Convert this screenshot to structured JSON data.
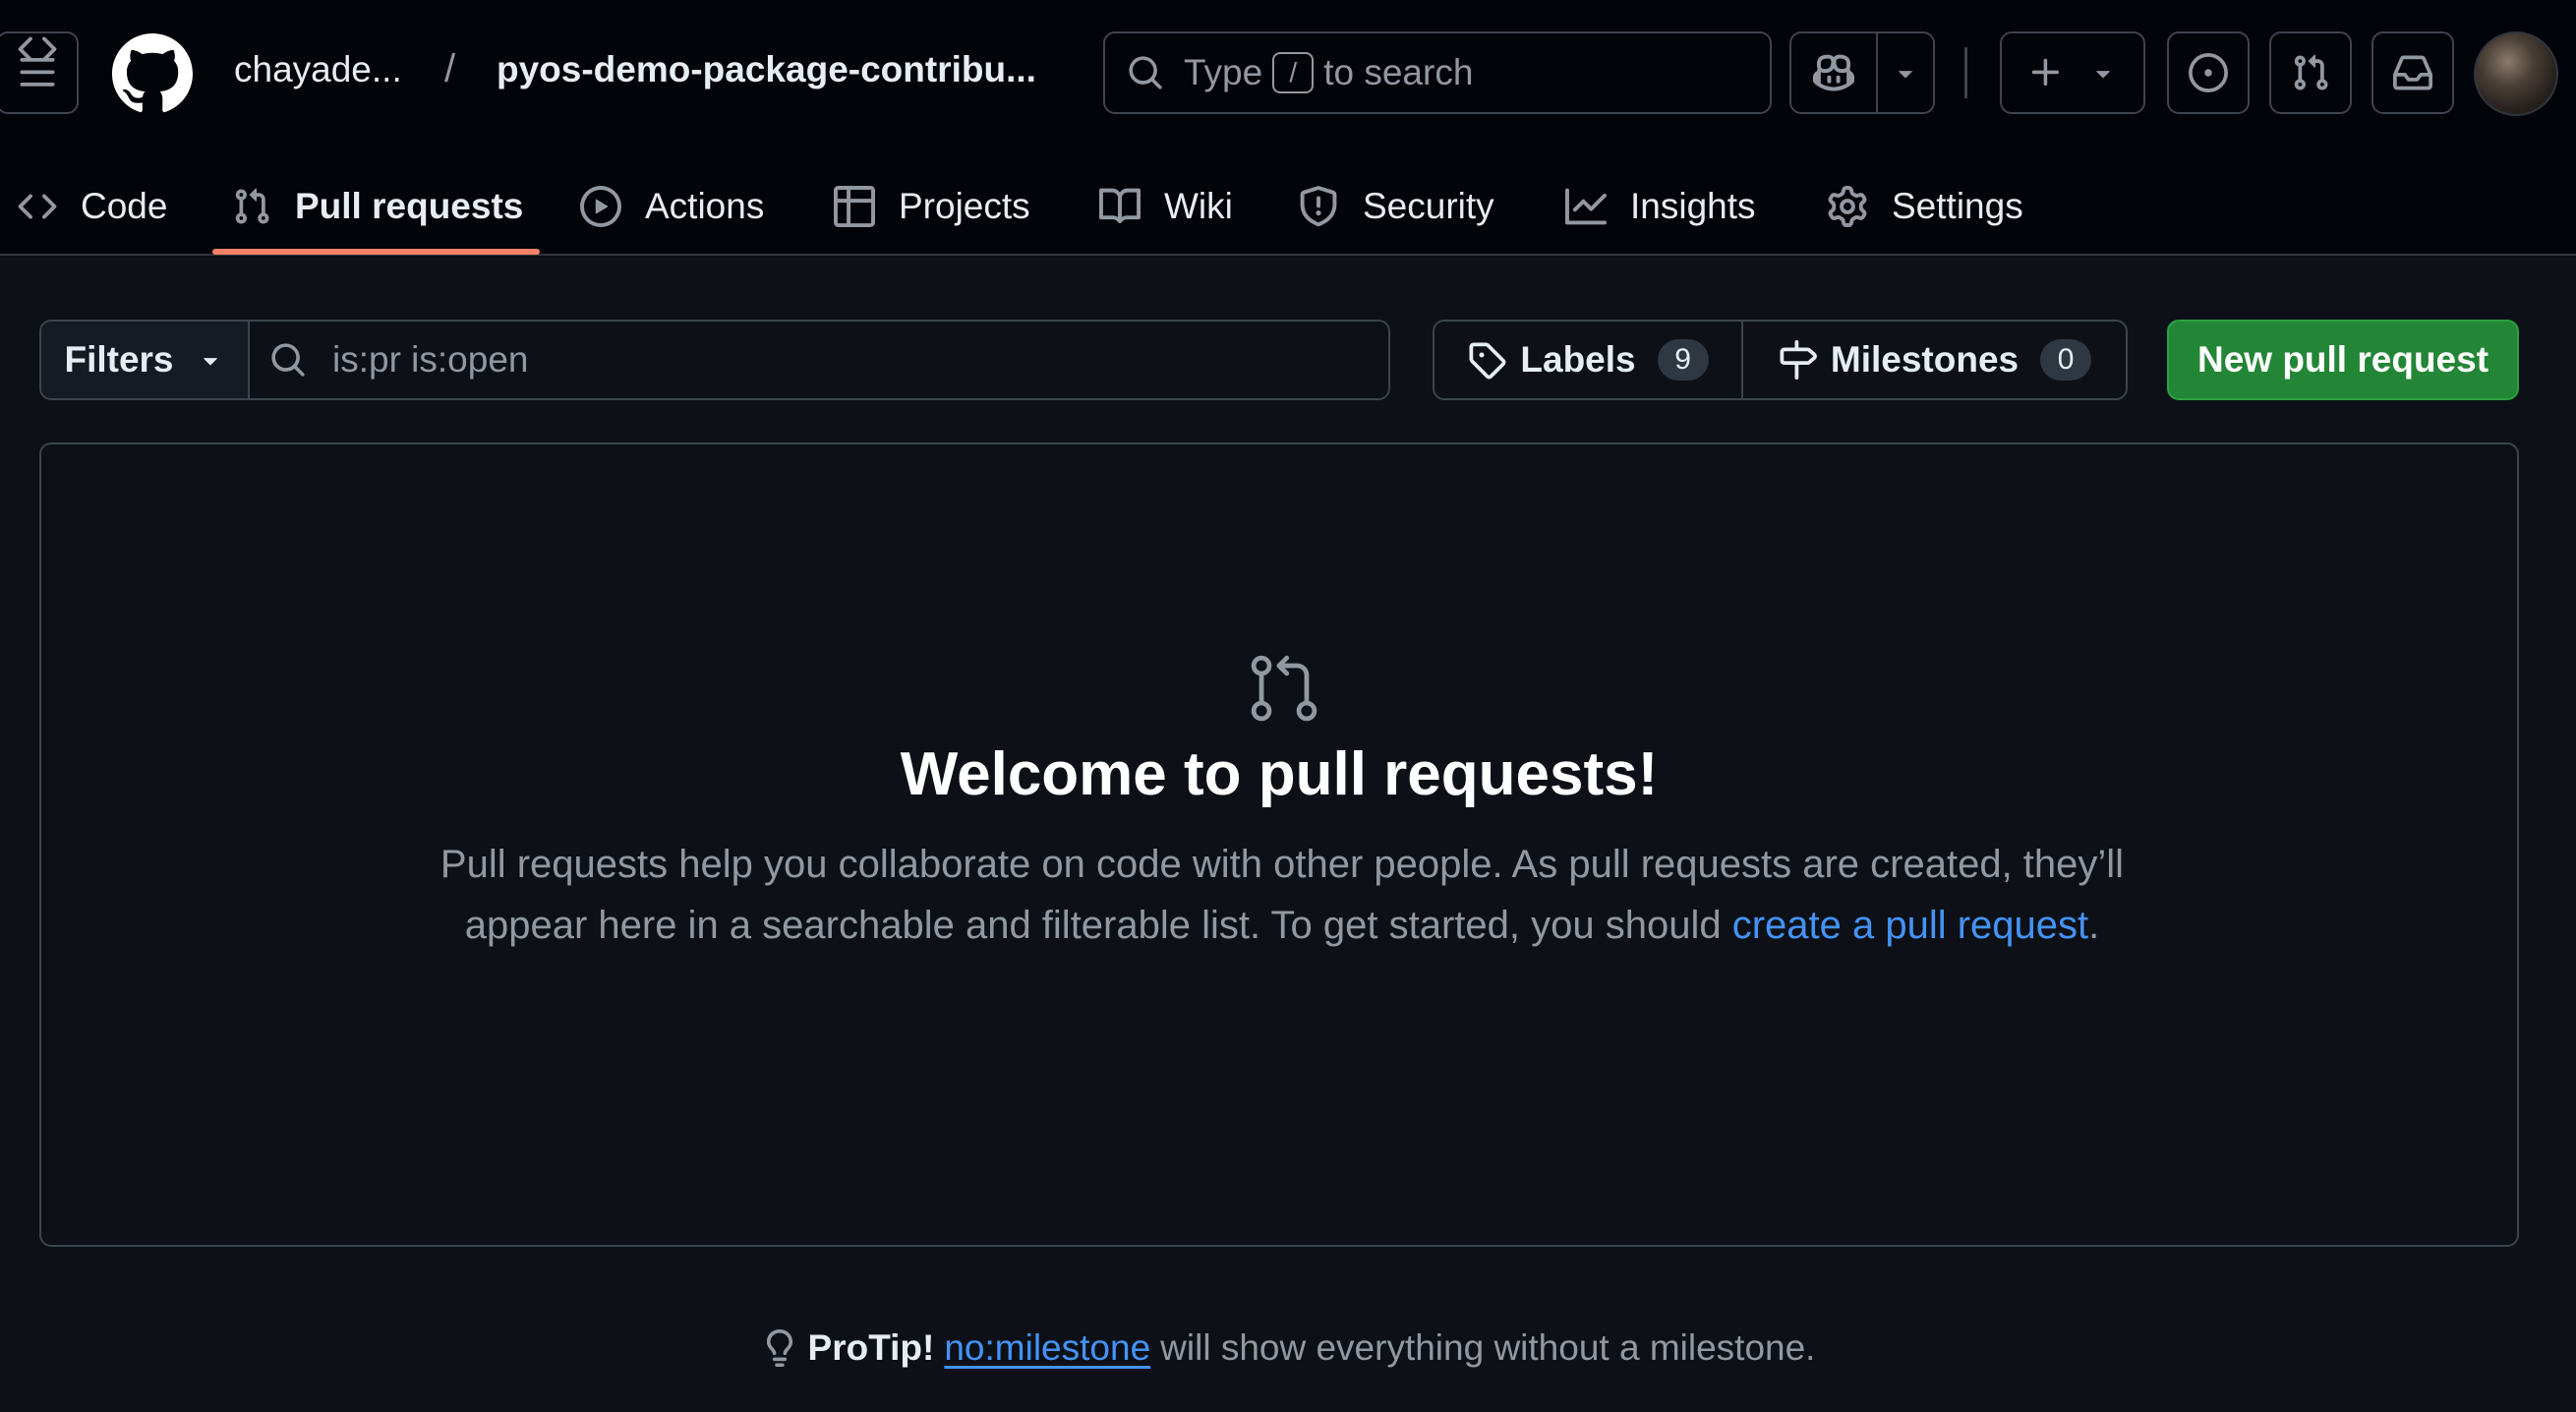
{
  "header": {
    "owner": "chayade...",
    "separator": "/",
    "repo": "pyos-demo-package-contribu...",
    "search": {
      "prefix": "Type",
      "key": "/",
      "suffix": "to search"
    },
    "icons": {
      "menu": "hamburger-icon",
      "logo": "github-logo",
      "search": "search-icon",
      "copilot": "copilot-icon",
      "plus": "plus-icon",
      "issues": "issue-opened-icon",
      "pulls": "git-pull-request-icon",
      "inbox": "inbox-icon"
    }
  },
  "tabs": [
    {
      "label": "Code",
      "icon": "code-icon"
    },
    {
      "label": "Pull requests",
      "icon": "git-pull-request-icon",
      "active": true
    },
    {
      "label": "Actions",
      "icon": "play-icon"
    },
    {
      "label": "Projects",
      "icon": "table-icon"
    },
    {
      "label": "Wiki",
      "icon": "book-icon"
    },
    {
      "label": "Security",
      "icon": "shield-icon"
    },
    {
      "label": "Insights",
      "icon": "graph-icon"
    },
    {
      "label": "Settings",
      "icon": "gear-icon"
    }
  ],
  "toolbar": {
    "filters_label": "Filters",
    "search_placeholder": "is:pr is:open",
    "labels_label": "Labels",
    "labels_count": "9",
    "milestones_label": "Milestones",
    "milestones_count": "0",
    "new_pr_label": "New pull request"
  },
  "blankslate": {
    "title": "Welcome to pull requests!",
    "text": "Pull requests help you collaborate on code with other people. As pull requests are created, they’ll appear here in a searchable and filterable list. To get started, you should",
    "link_text": "create a pull request",
    "end": "."
  },
  "protip": {
    "lead": "ProTip!",
    "link": "no:milestone",
    "rest": "will show everything without a milestone."
  },
  "colors": {
    "background": "#0d1117",
    "header": "#010409",
    "border": "#3d444d",
    "accent_tab": "#f78166",
    "primary_button": "#238636",
    "link": "#4493f8"
  }
}
